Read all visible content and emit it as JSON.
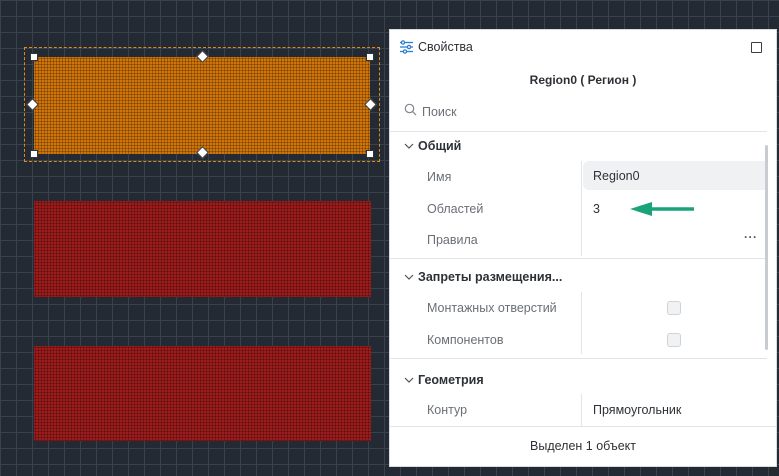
{
  "panel": {
    "title": "Свойства",
    "subtitle": "Region0 ( Регион )",
    "search_placeholder": "Поиск",
    "footer_status": "Выделен 1 объект"
  },
  "sections": {
    "general": {
      "title": "Общий",
      "name_label": "Имя",
      "name_value": "Region0",
      "areas_label": "Областей",
      "areas_value": "3",
      "rules_label": "Правила",
      "rules_button": "···"
    },
    "placement": {
      "title": "Запреты размещения...",
      "mounting_holes_label": "Монтажных отверстий",
      "mounting_holes_checked": false,
      "components_label": "Компонентов",
      "components_checked": false
    },
    "geometry": {
      "title": "Геометрия",
      "contour_label": "Контур",
      "contour_value": "Прямоугольник"
    }
  },
  "colors": {
    "canvas_background": "#232a33",
    "selected_region": "#d4770a",
    "other_regions": "#a01d1d",
    "annotation_arrow": "#1aa37a"
  },
  "icons": {
    "panel_icon": "sliders-icon",
    "maximize_icon": "square-icon",
    "search_icon": "search-icon",
    "chevron_icon": "chevron-down-icon"
  }
}
